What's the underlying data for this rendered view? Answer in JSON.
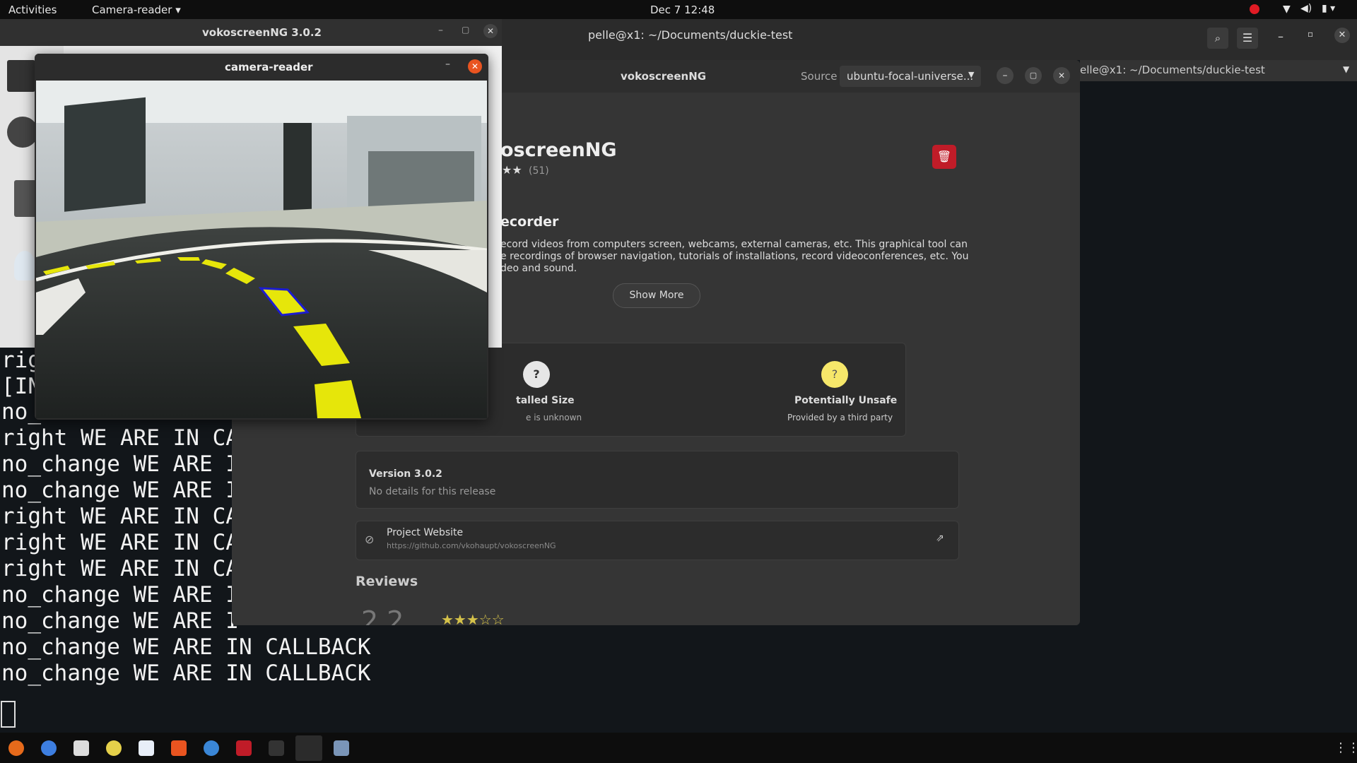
{
  "topbar": {
    "activities": "Activities",
    "app_menu": "Camera-reader ▾",
    "clock": "Dec 7  12:48"
  },
  "terminal": {
    "title": "pelle@x1: ~/Documents/duckie-test",
    "tab2_title": "elle@x1: ~/Documents/duckie-test",
    "lines_visible": [
      "rig",
      "[IN",
      "no_",
      "right WE ARE IN CA",
      "no_change WE ARE I",
      "no_change WE ARE I",
      "right WE ARE IN CA",
      "right WE ARE IN CA",
      "right WE ARE IN CA",
      "no_change WE ARE I",
      "no_change WE ARE I",
      "no_change WE ARE IN CALLBACK",
      "no_change WE ARE IN CALLBACK"
    ]
  },
  "software": {
    "window_title": "vokoscreenNG",
    "source_label": "Source",
    "source_value": "ubuntu-focal-universe...",
    "app_name": "oscreenNG",
    "rating_count": "(51)",
    "subtitle": "ecorder",
    "desc1": "ecord videos from computers screen, webcams, external cameras, etc. This graphical tool can",
    "desc2": "e recordings of browser navigation, tutorials of installations, record videoconferences, etc. You",
    "desc3": "deo and sound.",
    "show_more": "Show More",
    "size_title": "talled Size",
    "size_sub": "e is unknown",
    "safety_title": "Potentially Unsafe",
    "safety_sub": "Provided by a third party",
    "version": "Version 3.0.2",
    "version_details": "No details for this release",
    "website_title": "Project Website",
    "website_url": "https://github.com/vkohaupt/vokoscreenNG",
    "reviews": "Reviews"
  },
  "voko": {
    "title": "vokoscreenNG 3.0.2"
  },
  "camera": {
    "title": "camera-reader"
  },
  "colors": {
    "accent_red": "#c01c28",
    "lane_yellow": "#e6e60a"
  }
}
